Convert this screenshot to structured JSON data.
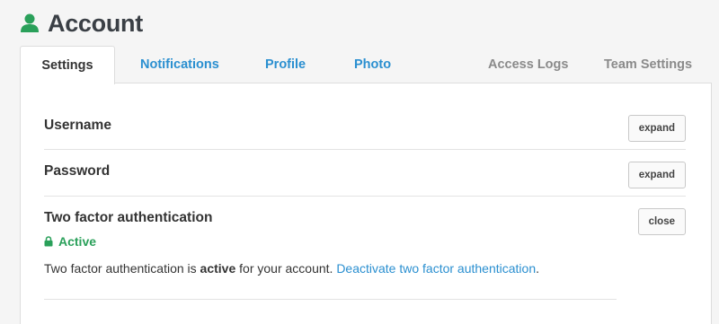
{
  "header": {
    "title": "Account"
  },
  "tabs": [
    {
      "label": "Settings"
    },
    {
      "label": "Notifications"
    },
    {
      "label": "Profile"
    },
    {
      "label": "Photo"
    },
    {
      "label": "Access Logs"
    },
    {
      "label": "Team Settings"
    }
  ],
  "settings": {
    "username": {
      "title": "Username",
      "button": "expand"
    },
    "password": {
      "title": "Password",
      "button": "expand"
    },
    "two_factor": {
      "title": "Two factor authentication",
      "button": "close",
      "status": "Active",
      "desc_prefix": "Two factor authentication is ",
      "desc_bold": "active",
      "desc_middle": " for your account. ",
      "desc_link": "Deactivate two factor authentication",
      "desc_suffix": "."
    }
  },
  "colors": {
    "link": "#2a8fd0",
    "active_status": "#2aa05a",
    "user_icon": "#2aa05a"
  }
}
